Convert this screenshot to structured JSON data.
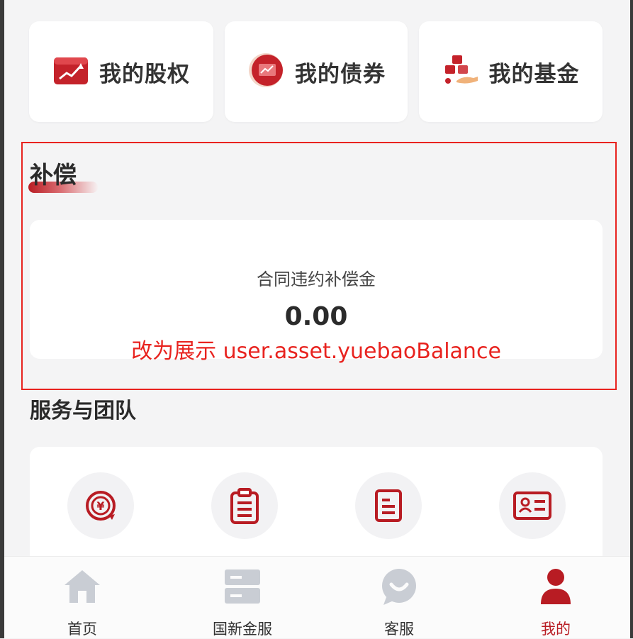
{
  "asset_cards": [
    {
      "label": "我的股权",
      "icon": "equity-chart-icon"
    },
    {
      "label": "我的债券",
      "icon": "bond-certificate-icon"
    },
    {
      "label": "我的基金",
      "icon": "fund-gold-bars-icon"
    }
  ],
  "compensation": {
    "section_title": "补偿",
    "card_label": "合同违约补偿金",
    "amount": "0.00",
    "annotation": "改为展示 user.asset.yuebaoBalance"
  },
  "services": {
    "section_title": "服务与团队",
    "icons": [
      "yuan-refresh-icon",
      "clipboard-icon",
      "document-list-icon",
      "id-card-icon"
    ]
  },
  "tabbar": {
    "items": [
      {
        "label": "首页",
        "icon": "home-icon",
        "active": false
      },
      {
        "label": "国新金服",
        "icon": "server-stack-icon",
        "active": false
      },
      {
        "label": "客服",
        "icon": "chat-bubble-icon",
        "active": false
      },
      {
        "label": "我的",
        "icon": "user-icon",
        "active": true
      }
    ]
  },
  "colors": {
    "brand_red": "#b81c23",
    "annotation_red": "#e8231f",
    "inactive_tab": "#c9cdd4"
  }
}
